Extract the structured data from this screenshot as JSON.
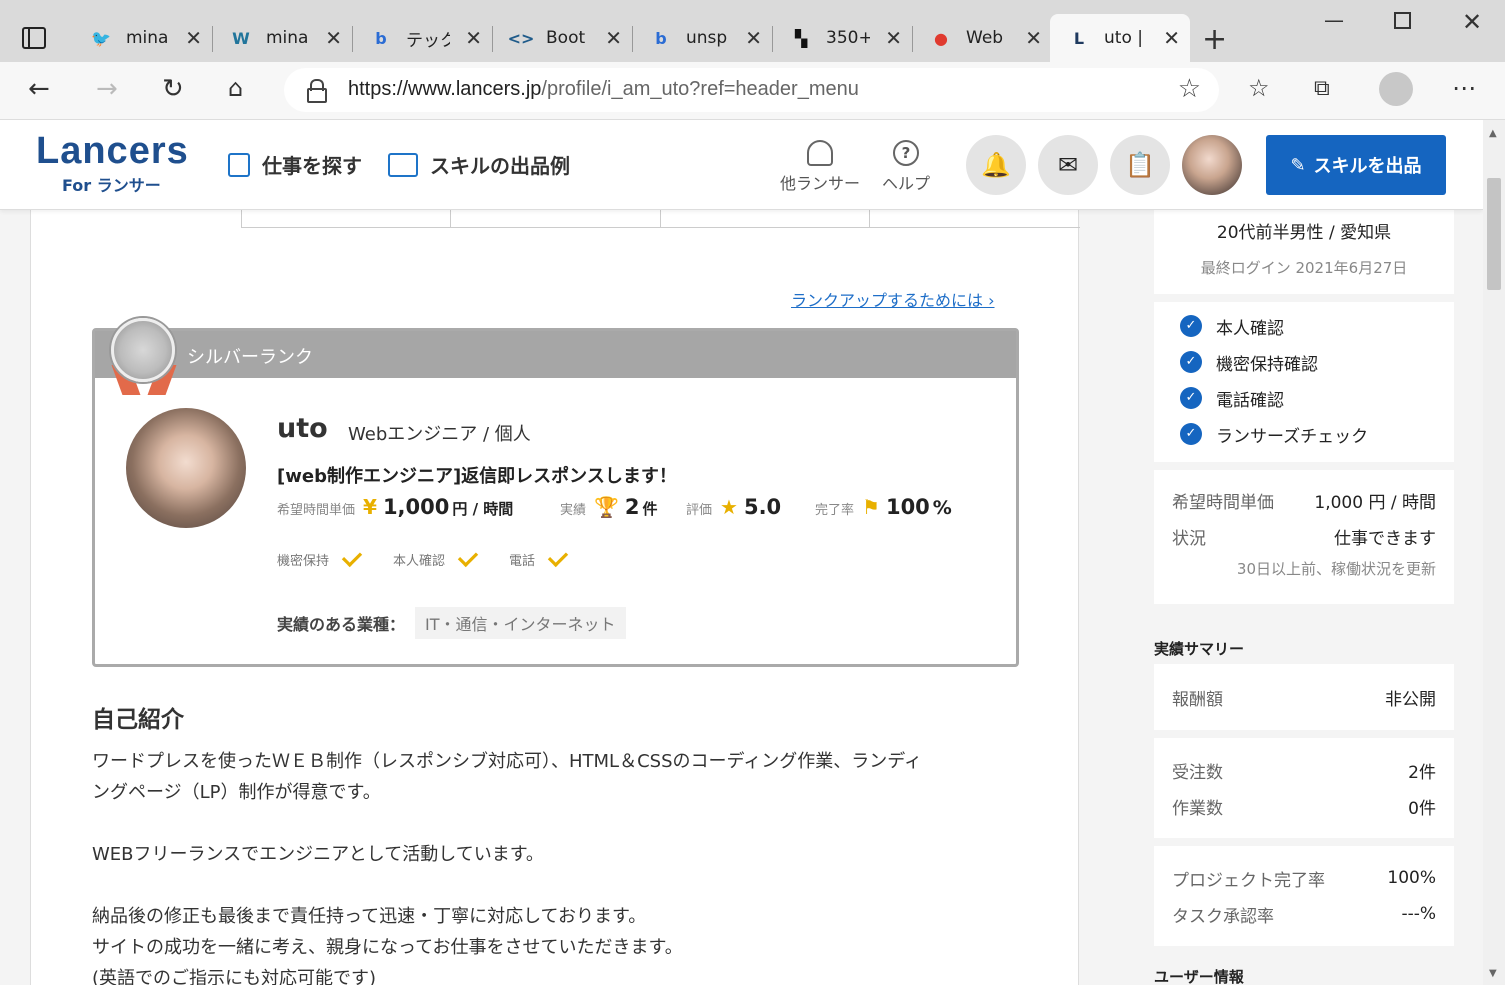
{
  "browser": {
    "tabs": [
      {
        "icon": "twitter-icon",
        "glyph": "🐦",
        "color": "#1da1f2",
        "title": "mina"
      },
      {
        "icon": "wordpress-icon",
        "glyph": "W",
        "color": "#21759b",
        "title": "mina"
      },
      {
        "icon": "bing-icon",
        "glyph": "b",
        "color": "#2b6cd4",
        "title": "テック"
      },
      {
        "icon": "code-icon",
        "glyph": "<>",
        "color": "#1f5b8a",
        "title": "Boot"
      },
      {
        "icon": "bing-icon",
        "glyph": "b",
        "color": "#2b6cd4",
        "title": "unsp"
      },
      {
        "icon": "unsplash-icon",
        "glyph": "▚",
        "color": "#111111",
        "title": "350+"
      },
      {
        "icon": "webflow-icon",
        "glyph": "●",
        "color": "#e03a2f",
        "title": "Web"
      },
      {
        "icon": "lancers-icon",
        "glyph": "L",
        "color": "#1f3a5f",
        "title": "uto |"
      }
    ],
    "url_host": "https://www.lancers.jp",
    "url_path": "/profile/i_am_uto?ref=header_menu"
  },
  "header": {
    "logo": "Lancers",
    "logo_sub": "For ランサー",
    "nav_find_jobs": "仕事を探す",
    "nav_skill_examples": "スキルの出品例",
    "other_lancers": "他ランサー",
    "help": "ヘルプ",
    "cta_label": "スキルを出品"
  },
  "profile": {
    "rankup_link": "ランクアップするためには",
    "rank_label": "シルバーランク",
    "name": "uto",
    "role": "Webエンジニア",
    "type": "個人",
    "catchphrase": "[web制作エンジニア]返信即レスポンスします！",
    "stats": {
      "rate_label": "希望時間単価",
      "rate_value": "1,000",
      "rate_unit": "円 / 時間",
      "jobs_label": "実績",
      "jobs_value": "2",
      "jobs_unit": "件",
      "rating_label": "評価",
      "rating_value": "5.0",
      "completion_label": "完了率",
      "completion_value": "100",
      "completion_unit": "%"
    },
    "checks": [
      "機密保持",
      "本人確認",
      "電話"
    ],
    "industry_label": "実績のある業種：",
    "industry_value": "IT・通信・インターネット"
  },
  "intro": {
    "heading": "自己紹介",
    "lines": [
      "ワードプレスを使ったＷＥＢ制作（レスポンシブ対応可）、HTML＆CSSのコーディング作業、ランディ",
      "ングページ（LP）制作が得意です。",
      "",
      "WEBフリーランスでエンジニアとして活動しています。",
      "",
      "納品後の修正も最後まで責任持って迅速・丁寧に対応しております。",
      "サイトの成功を一緒に考え、親身になってお仕事をさせていただきます。",
      "(英語でのご指示にも対応可能です)"
    ]
  },
  "sidebar": {
    "demographic": "20代前半男性 / 愛知県",
    "last_login": "最終ログイン 2021年6月27日",
    "verifications": [
      "本人確認",
      "機密保持確認",
      "電話確認",
      "ランサーズチェック"
    ],
    "rate_label": "希望時間単価",
    "rate_value": "1,000 円 / 時間",
    "status_label": "状況",
    "status_value": "仕事できます",
    "status_note": "30日以上前、稼働状況を更新",
    "summary_title": "実績サマリー",
    "reward_label": "報酬額",
    "reward_value": "非公開",
    "orders_label": "受注数",
    "orders_value": "2件",
    "work_label": "作業数",
    "work_value": "0件",
    "project_rate_label": "プロジェクト完了率",
    "project_rate_value": "100%",
    "task_rate_label": "タスク承認率",
    "task_rate_value": "---%",
    "user_info_title": "ユーザー情報"
  }
}
